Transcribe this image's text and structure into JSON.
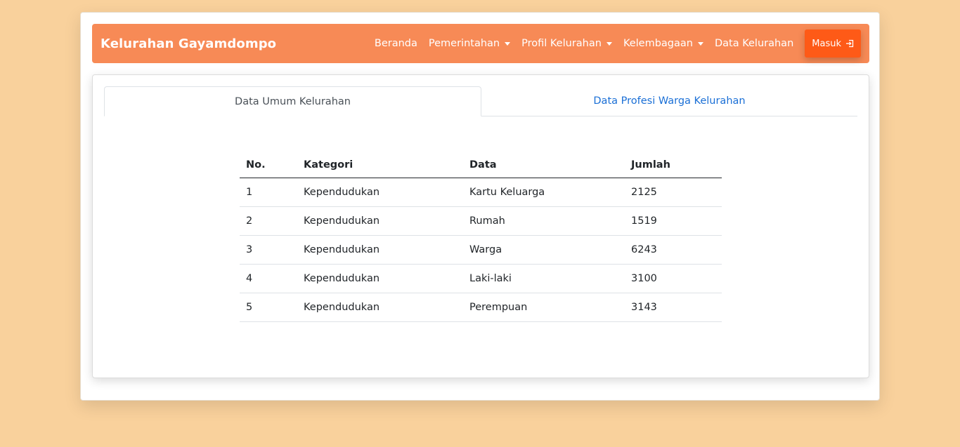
{
  "navbar": {
    "brand": "Kelurahan Gayamdompo",
    "links": [
      {
        "label": "Beranda",
        "dropdown": false
      },
      {
        "label": "Pemerintahan",
        "dropdown": true
      },
      {
        "label": "Profil Kelurahan",
        "dropdown": true
      },
      {
        "label": "Kelembagaan",
        "dropdown": true
      },
      {
        "label": "Data Kelurahan",
        "dropdown": false
      }
    ],
    "login_label": "Masuk"
  },
  "tabs": [
    {
      "label": "Data Umum Kelurahan",
      "active": true
    },
    {
      "label": "Data Profesi Warga Kelurahan",
      "active": false
    }
  ],
  "table": {
    "headers": [
      "No.",
      "Kategori",
      "Data",
      "Jumlah"
    ],
    "rows": [
      [
        "1",
        "Kependudukan",
        "Kartu Keluarga",
        "2125"
      ],
      [
        "2",
        "Kependudukan",
        "Rumah",
        "1519"
      ],
      [
        "3",
        "Kependudukan",
        "Warga",
        "6243"
      ],
      [
        "4",
        "Kependudukan",
        "Laki-laki",
        "3100"
      ],
      [
        "5",
        "Kependudukan",
        "Perempuan",
        "3143"
      ]
    ]
  },
  "colors": {
    "background": "#f9d19c",
    "navbar": "#f78a56",
    "login_button": "#fe5a17",
    "link": "#1a6fd6"
  },
  "icons": {
    "login": "box-arrow-in-right-icon",
    "dropdown": "caret-down-icon"
  }
}
